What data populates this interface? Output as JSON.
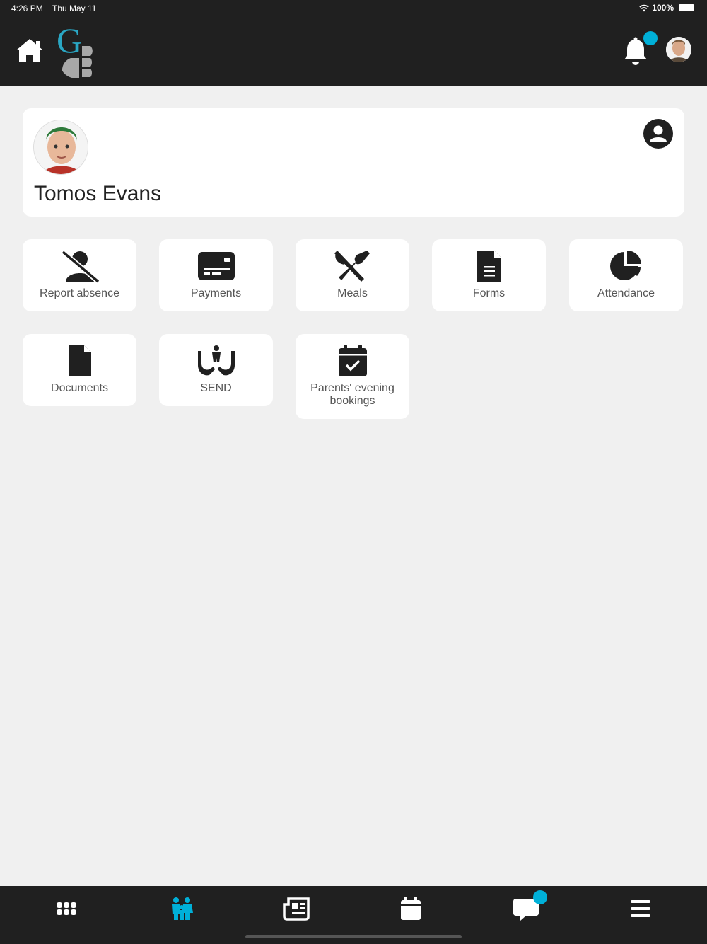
{
  "status_bar": {
    "time": "4:26 PM",
    "date": "Thu May 11",
    "battery": "100%"
  },
  "header": {
    "home_icon": "home-icon",
    "logo_icon": "school-logo",
    "bell_icon": "bell-icon",
    "accent_color": "#00b0d8"
  },
  "student": {
    "name": "Tomos Evans",
    "profile_icon": "user-circle-icon"
  },
  "tiles": [
    {
      "label": "Report absence",
      "icon": "user-slash-icon"
    },
    {
      "label": "Payments",
      "icon": "credit-card-icon"
    },
    {
      "label": "Meals",
      "icon": "utensils-icon"
    },
    {
      "label": "Forms",
      "icon": "file-lines-icon"
    },
    {
      "label": "Attendance",
      "icon": "pie-chart-icon"
    },
    {
      "label": "Documents",
      "icon": "file-icon"
    },
    {
      "label": "SEND",
      "icon": "hands-holding-child-icon"
    },
    {
      "label": "Parents' evening bookings",
      "icon": "calendar-check-icon"
    }
  ],
  "bottom_nav": [
    {
      "icon": "grid-icon",
      "active": false
    },
    {
      "icon": "family-icon",
      "active": true
    },
    {
      "icon": "newspaper-icon",
      "active": false
    },
    {
      "icon": "calendar-icon",
      "active": false
    },
    {
      "icon": "chat-icon",
      "active": false
    },
    {
      "icon": "menu-icon",
      "active": false
    }
  ]
}
